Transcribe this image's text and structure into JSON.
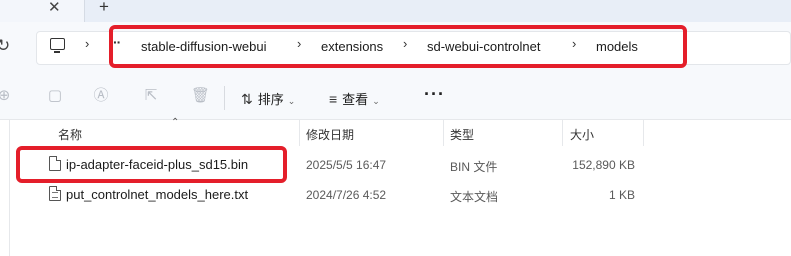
{
  "window": {
    "close_glyph": "✕",
    "new_tab_glyph": "+"
  },
  "nav": {
    "refresh_glyph": "↻"
  },
  "address": {
    "more_glyph": "··",
    "separator_glyph": "›",
    "breadcrumbs": [
      "stable-diffusion-webui",
      "extensions",
      "sd-webui-controlnet",
      "models"
    ]
  },
  "toolbar": {
    "sort_label": "排序",
    "view_label": "查看",
    "more_glyph": "···",
    "sort_icon_glyph": "⇅",
    "view_icon_glyph": "≡",
    "caret_glyph": "⌄",
    "disabled_icons": [
      "new-icon",
      "paste-icon",
      "rename-icon",
      "share-icon",
      "delete-icon"
    ]
  },
  "columns": {
    "sort_glyph": "⌃",
    "name": "名称",
    "modified": "修改日期",
    "type": "类型",
    "size": "大小"
  },
  "files": [
    {
      "name": "ip-adapter-faceid-plus_sd15.bin",
      "modified": "2025/5/5 16:47",
      "type": "BIN 文件",
      "size": "152,890 KB",
      "icon": "file-icon"
    },
    {
      "name": "put_controlnet_models_here.txt",
      "modified": "2024/7/26 4:52",
      "type": "文本文档",
      "size": "1 KB",
      "icon": "text-file-icon"
    }
  ],
  "highlight_color": "#e41e2a"
}
